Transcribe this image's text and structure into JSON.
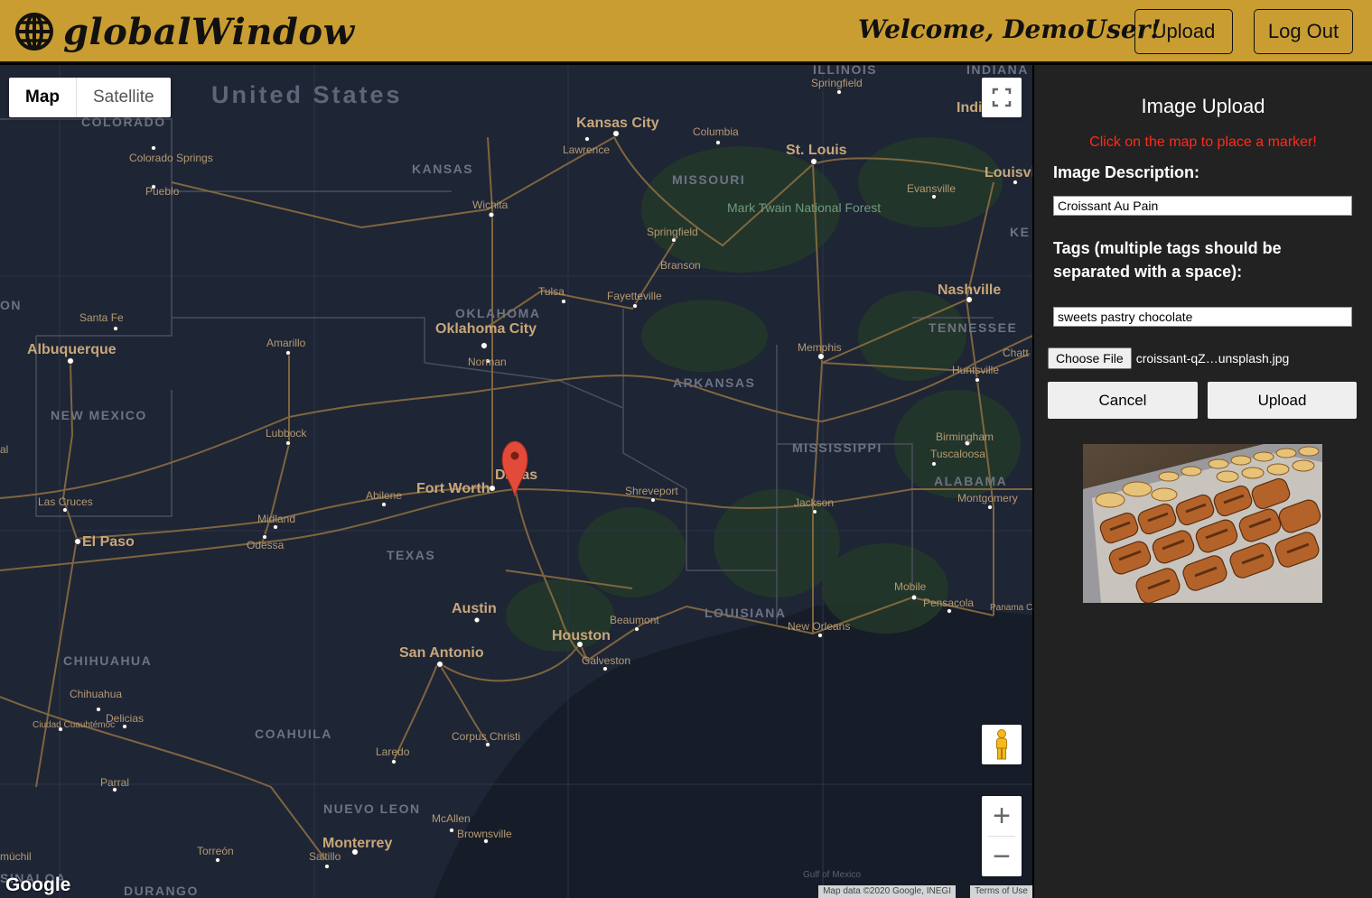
{
  "header": {
    "logo_text": "globalWindow",
    "welcome": "Welcome, DemoUser!",
    "upload_label": "Upload",
    "logout_label": "Log Out",
    "color": "#c99d32"
  },
  "map": {
    "type_control": {
      "map_label": "Map",
      "satellite_label": "Satellite",
      "active": "Map"
    },
    "zoom_in": "+",
    "zoom_out": "−",
    "attribution": "Map data ©2020 Google, INEGI",
    "terms": "Terms of Use",
    "google_logo": "Google",
    "labels": {
      "united_states": "United States",
      "colorado": "COLORADO",
      "kansas": "KANSAS",
      "missouri": "MISSOURI",
      "oklahoma": "OKLAHOMA",
      "arkansas": "ARKANSAS",
      "tennessee": "TENNESSEE",
      "new_mexico": "NEW MEXICO",
      "texas": "TEXAS",
      "mississippi": "MISSISSIPPI",
      "alabama": "ALABAMA",
      "louisiana": "LOUISIANA",
      "chihuahua_state": "CHIHUAHUA",
      "coahuila": "COAHUILA",
      "nuevo_leon": "NUEVO LEON",
      "durango": "DURANGO",
      "sinaloa": "SINALOA",
      "illinois": "ILLINOIS",
      "indiana": "INDIANA",
      "kansas_city": "Kansas City",
      "st_louis": "St. Louis",
      "columbia": "Columbia",
      "lawrence": "Lawrence",
      "springfield_il": "Springfield",
      "indi": "Indi",
      "louisv": "Louisvi",
      "evansville": "Evansville",
      "colorado_springs": "Colorado Springs",
      "pueblo": "Pueblo",
      "wichita": "Wichita",
      "mark_twain": "Mark Twain National Forest",
      "springfield_mo": "Springfield",
      "branson": "Branson",
      "tulsa": "Tulsa",
      "fayetteville": "Fayetteville",
      "nashville": "Nashville",
      "santa_fe": "Santa Fe",
      "albuquerque": "Albuquerque",
      "amarillo": "Amarillo",
      "oklahoma_city": "Oklahoma City",
      "norman": "Norman",
      "memphis": "Memphis",
      "chatt": "Chatt",
      "huntsville": "Huntsville",
      "lubbock": "Lubbock",
      "birmingham": "Birmingham",
      "tuscaloosa": "Tuscaloosa",
      "dallas": "Dallas",
      "fort_worth": "Fort Worth",
      "abilene": "Abilene",
      "shreveport": "Shreveport",
      "jackson": "Jackson",
      "montgomery": "Montgomery",
      "las_cruces": "Las Cruces",
      "midland": "Midland",
      "odessa": "Odessa",
      "el_paso": "El Paso",
      "austin": "Austin",
      "houston": "Houston",
      "beaumont": "Beaumont",
      "san_antonio": "San Antonio",
      "galveston": "Galveston",
      "new_orleans": "New Orleans",
      "mobile": "Mobile",
      "pensacola": "Pensacola",
      "panama_city": "Panama City",
      "chihuahua_city": "Chihuahua",
      "delicias": "Delicias",
      "ciudad_cuauhtemoc": "Ciudad Cuauhtémoc",
      "corpus_christi": "Corpus Christi",
      "laredo": "Laredo",
      "parral": "Parral",
      "mcallen": "McAllen",
      "brownsville": "Brownsville",
      "monterrey": "Monterrey",
      "saltillo": "Saltillo",
      "torreon": "Torreón",
      "gulf": "Gulf of Mexico",
      "mochil": "múchil",
      "on": "ON",
      "al": "al",
      "ke": "KE"
    }
  },
  "panel": {
    "title": "Image Upload",
    "hint": "Click on the map to place a marker!",
    "description_label": "Image Description:",
    "description_value": "Croissant Au Pain",
    "tags_label": "Tags (multiple tags should be separated with a space):",
    "tags_value": "sweets pastry chocolate",
    "choose_file_label": "Choose File",
    "file_name": "croissant-qZ…unsplash.jpg",
    "cancel_label": "Cancel",
    "upload_label": "Upload",
    "hint_color": "#ff2a1a"
  }
}
